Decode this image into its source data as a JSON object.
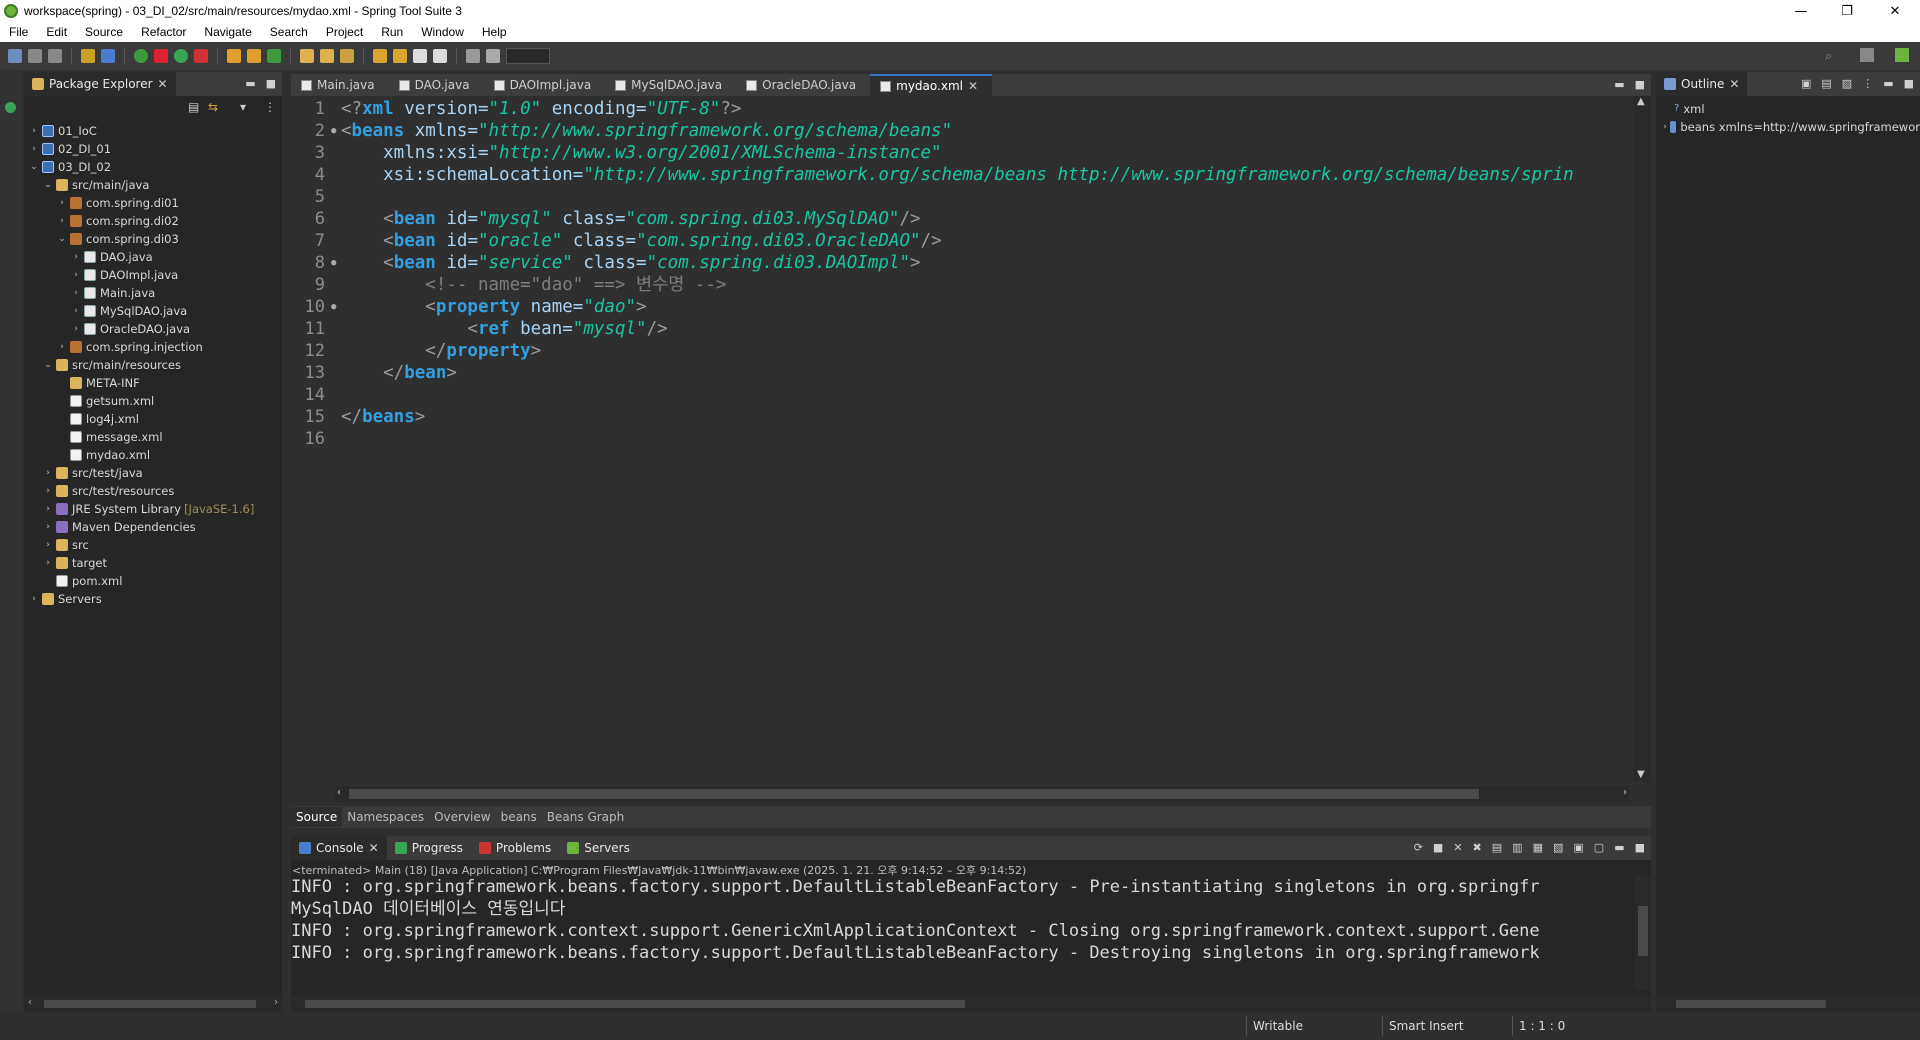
{
  "window": {
    "title": "workspace(spring) - 03_DI_02/src/main/resources/mydao.xml - Spring Tool Suite 3",
    "controls": [
      "—",
      "❐",
      "✕"
    ]
  },
  "menu": [
    "File",
    "Edit",
    "Source",
    "Refactor",
    "Navigate",
    "Search",
    "Project",
    "Run",
    "Window",
    "Help"
  ],
  "package_explorer": {
    "title": "Package Explorer",
    "items": [
      {
        "label": "01_IoC",
        "depth": 0,
        "twisty": "›",
        "icon": "project-icon"
      },
      {
        "label": "02_DI_01",
        "depth": 0,
        "twisty": "›",
        "icon": "project-icon"
      },
      {
        "label": "03_DI_02",
        "depth": 0,
        "twisty": "⌄",
        "icon": "project-icon"
      },
      {
        "label": "src/main/java",
        "depth": 1,
        "twisty": "⌄",
        "icon": "folder-icon"
      },
      {
        "label": "com.spring.di01",
        "depth": 2,
        "twisty": "›",
        "icon": "package-icon"
      },
      {
        "label": "com.spring.di02",
        "depth": 2,
        "twisty": "›",
        "icon": "package-icon"
      },
      {
        "label": "com.spring.di03",
        "depth": 2,
        "twisty": "⌄",
        "icon": "package-icon"
      },
      {
        "label": "DAO.java",
        "depth": 3,
        "twisty": "›",
        "icon": "java-file-icon"
      },
      {
        "label": "DAOImpl.java",
        "depth": 3,
        "twisty": "›",
        "icon": "java-file-icon"
      },
      {
        "label": "Main.java",
        "depth": 3,
        "twisty": "›",
        "icon": "java-file-icon"
      },
      {
        "label": "MySqlDAO.java",
        "depth": 3,
        "twisty": "›",
        "icon": "java-file-icon"
      },
      {
        "label": "OracleDAO.java",
        "depth": 3,
        "twisty": "›",
        "icon": "java-file-icon"
      },
      {
        "label": "com.spring.injection",
        "depth": 2,
        "twisty": "›",
        "icon": "package-icon"
      },
      {
        "label": "src/main/resources",
        "depth": 1,
        "twisty": "⌄",
        "icon": "folder-icon"
      },
      {
        "label": "META-INF",
        "depth": 2,
        "twisty": "",
        "icon": "folder-icon"
      },
      {
        "label": "getsum.xml",
        "depth": 2,
        "twisty": "",
        "icon": "xml-file-icon"
      },
      {
        "label": "log4j.xml",
        "depth": 2,
        "twisty": "",
        "icon": "xml-file-icon"
      },
      {
        "label": "message.xml",
        "depth": 2,
        "twisty": "",
        "icon": "xml-file-icon"
      },
      {
        "label": "mydao.xml",
        "depth": 2,
        "twisty": "",
        "icon": "xml-file-icon"
      },
      {
        "label": "src/test/java",
        "depth": 1,
        "twisty": "›",
        "icon": "folder-icon"
      },
      {
        "label": "src/test/resources",
        "depth": 1,
        "twisty": "›",
        "icon": "folder-icon"
      },
      {
        "label": "JRE System Library",
        "decor": "[JavaSE-1.6]",
        "depth": 1,
        "twisty": "›",
        "icon": "library-icon"
      },
      {
        "label": "Maven Dependencies",
        "depth": 1,
        "twisty": "›",
        "icon": "library-icon"
      },
      {
        "label": "src",
        "depth": 1,
        "twisty": "›",
        "icon": "folder-icon"
      },
      {
        "label": "target",
        "depth": 1,
        "twisty": "›",
        "icon": "folder-icon"
      },
      {
        "label": "pom.xml",
        "depth": 1,
        "twisty": "",
        "icon": "xml-file-icon"
      },
      {
        "label": "Servers",
        "depth": 0,
        "twisty": "›",
        "icon": "folder-icon"
      }
    ]
  },
  "editor": {
    "tabs": [
      "Main.java",
      "DAO.java",
      "DAOImpl.java",
      "MySqlDAO.java",
      "OracleDAO.java",
      "mydao.xml"
    ],
    "active_tab": "mydao.xml",
    "lines": [
      {
        "n": "1",
        "m": "",
        "t": [
          [
            "p",
            "<?"
          ],
          [
            "k",
            "xml"
          ],
          [
            "a",
            " version="
          ],
          [
            "v",
            "\"1.0\""
          ],
          [
            "a",
            " encoding="
          ],
          [
            "v",
            "\"UTF-8\""
          ],
          [
            "p",
            "?>"
          ]
        ]
      },
      {
        "n": "2",
        "m": "●",
        "t": [
          [
            "p",
            "<"
          ],
          [
            "k",
            "beans"
          ],
          [
            "a",
            " xmlns="
          ],
          [
            "v",
            "\"http://www.springframework.org/schema/beans\""
          ]
        ]
      },
      {
        "n": "3",
        "m": "",
        "t": [
          [
            "a",
            "    xmlns:xsi="
          ],
          [
            "v",
            "\"http://www.w3.org/2001/XMLSchema-instance\""
          ]
        ]
      },
      {
        "n": "4",
        "m": "",
        "t": [
          [
            "a",
            "    xsi:schemaLocation="
          ],
          [
            "v",
            "\"http://www.springframework.org/schema/beans http://www.springframework.org/schema/beans/sprin"
          ]
        ]
      },
      {
        "n": "5",
        "m": "",
        "t": []
      },
      {
        "n": "6",
        "m": "",
        "t": [
          [
            "p",
            "    <"
          ],
          [
            "k",
            "bean"
          ],
          [
            "a",
            " id="
          ],
          [
            "v",
            "\"mysql\""
          ],
          [
            "a",
            " class="
          ],
          [
            "v",
            "\"com.spring.di03.MySqlDAO\""
          ],
          [
            "p",
            "/>"
          ]
        ]
      },
      {
        "n": "7",
        "m": "",
        "t": [
          [
            "p",
            "    <"
          ],
          [
            "k",
            "bean"
          ],
          [
            "a",
            " id="
          ],
          [
            "v",
            "\"oracle\""
          ],
          [
            "a",
            " class="
          ],
          [
            "v",
            "\"com.spring.di03.OracleDAO\""
          ],
          [
            "p",
            "/>"
          ]
        ]
      },
      {
        "n": "8",
        "m": "●",
        "t": [
          [
            "p",
            "    <"
          ],
          [
            "k",
            "bean"
          ],
          [
            "a",
            " id="
          ],
          [
            "v",
            "\"service\""
          ],
          [
            "a",
            " class="
          ],
          [
            "v",
            "\"com.spring.di03.DAOImpl\""
          ],
          [
            "p",
            ">"
          ]
        ]
      },
      {
        "n": "9",
        "m": "",
        "t": [
          [
            "c",
            "        <!-- name=\"dao\" ==> 변수명 -->"
          ]
        ]
      },
      {
        "n": "10",
        "m": "●",
        "t": [
          [
            "p",
            "        <"
          ],
          [
            "k",
            "property"
          ],
          [
            "a",
            " name="
          ],
          [
            "v",
            "\"dao\""
          ],
          [
            "p",
            ">"
          ]
        ]
      },
      {
        "n": "11",
        "m": "",
        "t": [
          [
            "p",
            "            <"
          ],
          [
            "k",
            "ref"
          ],
          [
            "a",
            " bean="
          ],
          [
            "v",
            "\"mysql\""
          ],
          [
            "p",
            "/>"
          ]
        ]
      },
      {
        "n": "12",
        "m": "",
        "t": [
          [
            "p",
            "        </"
          ],
          [
            "k",
            "property"
          ],
          [
            "p",
            ">"
          ]
        ]
      },
      {
        "n": "13",
        "m": "",
        "t": [
          [
            "p",
            "    </"
          ],
          [
            "k",
            "bean"
          ],
          [
            "p",
            ">"
          ]
        ]
      },
      {
        "n": "14",
        "m": "",
        "t": []
      },
      {
        "n": "15",
        "m": "",
        "t": [
          [
            "p",
            "</"
          ],
          [
            "k",
            "beans"
          ],
          [
            "p",
            ">"
          ]
        ]
      },
      {
        "n": "16",
        "m": "",
        "t": []
      }
    ],
    "subtabs": [
      "Source",
      "Namespaces",
      "Overview",
      "beans",
      "Beans Graph"
    ]
  },
  "outline": {
    "title": "Outline",
    "items": [
      "xml",
      "beans xmlns=http://www.springframewor"
    ]
  },
  "console": {
    "tabs": [
      "Console",
      "Progress",
      "Problems",
      "Servers"
    ],
    "terminated": "<terminated> Main (18) [Java Application] C:₩Program Files₩Java₩jdk-11₩bin₩javaw.exe  (2025. 1. 21. 오후 9:14:52 – 오후 9:14:52)",
    "lines": [
      "INFO : org.springframework.beans.factory.support.DefaultListableBeanFactory - Pre-instantiating singletons in org.springfr",
      "MySqlDAO 데이터베이스 연동입니다",
      "INFO : org.springframework.context.support.GenericXmlApplicationContext - Closing org.springframework.context.support.Gene",
      "INFO : org.springframework.beans.factory.support.DefaultListableBeanFactory - Destroying singletons in org.springframework"
    ]
  },
  "status": {
    "writable": "Writable",
    "insert_mode": "Smart Insert",
    "position": "1 : 1 : 0"
  },
  "colors": {
    "keyword": "#32a0e0",
    "attribute": "#a8d4f5",
    "value": "#17c6a3",
    "comment": "#7d7d7d"
  }
}
